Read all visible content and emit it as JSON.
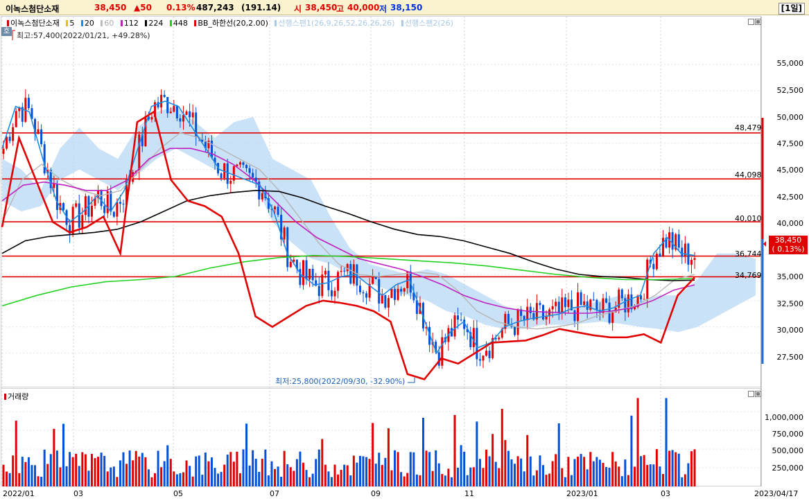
{
  "header": {
    "name": "이녹스첨단소재",
    "price": "38,450",
    "change": "▲50",
    "change_pct": "0.13%",
    "volume": "487,243",
    "volume_change": "(191.14)",
    "open_label": "시",
    "open": "38,450",
    "high_label": "고",
    "high": "40,000",
    "low_label": "저",
    "low": "38,150",
    "period": "[1일]"
  },
  "legend": {
    "title": "이녹스첨단소재",
    "ma5": "5",
    "ma20": "20",
    "ma60": "60",
    "ma112": "112",
    "ma224": "224",
    "ma448": "448",
    "bb": "BB_하한선(20,2.00)",
    "span1": "선행스팬1(26,9,26,52,26,26,26)",
    "span2": "선행스팬2(26)",
    "tag": "호"
  },
  "annotations": {
    "max": "최고:57,400(2022/01/21, +49.28%)",
    "min": "최저:25,800(2022/09/30, -32.90%)"
  },
  "price_axis": [
    "55,000",
    "52,500",
    "50,000",
    "47,500",
    "45,000",
    "42,500",
    "40,000",
    "35,000",
    "32,500",
    "30,000",
    "27,500"
  ],
  "levels": [
    "48,479",
    "44,098",
    "40,010",
    "36,744",
    "34,769"
  ],
  "current_box": {
    "price": "38,450",
    "pct": "( 0.13%)"
  },
  "volume_panel": {
    "label": "거래량",
    "axis": [
      "1,000,000",
      "750,000",
      "500,000",
      "250,000"
    ]
  },
  "x_axis": [
    "2022/01",
    "03",
    "05",
    "07",
    "09",
    "11",
    "2023/01",
    "03",
    "2023/04/17"
  ],
  "colors": {
    "up": "#e00000",
    "down": "#0050d8",
    "ma5": "#e8c000",
    "ma20": "#1e8ae0",
    "ma60": "#b8b8b8",
    "ma112": "#c020c0",
    "ma224": "#000000",
    "ma448": "#22d022",
    "bb": "#e00000",
    "cloud": "#b8d8f4",
    "level": "#e00000"
  },
  "chart_data": {
    "type": "line",
    "title": "",
    "xlabel": "",
    "ylabel": "",
    "ylim": [
      24500,
      58500
    ],
    "y_ticks": [
      27500,
      30000,
      32500,
      35000,
      40000,
      42500,
      45000,
      47500,
      50000,
      52500,
      55000
    ],
    "horizontal_levels": [
      48479,
      44098,
      40010,
      36744,
      34769
    ],
    "last_close": 38450,
    "max_point": {
      "date": "2022/01/21",
      "value": 57400
    },
    "min_point": {
      "date": "2022/09/30",
      "value": 25800
    },
    "series": [
      {
        "name": "20",
        "values": [
          47000,
          51000,
          50500,
          46000,
          42000,
          40000,
          41000,
          42500,
          41000,
          43000,
          47000,
          51000,
          51500,
          51000,
          49000,
          47000,
          45000,
          44500,
          44000,
          43500,
          41000,
          37000,
          35000,
          34000,
          34200,
          34800,
          35000,
          34000,
          33000,
          34000,
          34500,
          31000,
          27500,
          29500,
          30500,
          28000,
          28500,
          30000,
          30500,
          30800,
          31000,
          31200,
          31800,
          32000,
          31500,
          31800,
          32500,
          33000,
          37000,
          38500,
          37000,
          36800
        ]
      },
      {
        "name": "224",
        "values": [
          37000,
          38200,
          38600,
          38800,
          39000,
          39300,
          40000,
          41000,
          42000,
          42500,
          42800,
          43000,
          42900,
          42300,
          41500,
          40800,
          40000,
          39300,
          38800,
          38600,
          38200,
          37600,
          37000,
          36200,
          35500,
          35000,
          34800,
          34700,
          34500,
          34400,
          34450
        ]
      },
      {
        "name": "448",
        "values": [
          32000,
          33000,
          33800,
          34300,
          34500,
          34800,
          35600,
          36200,
          36600,
          36800,
          36700,
          36500,
          36300,
          36100,
          35800,
          35400,
          35000,
          34700,
          34500,
          34500,
          34600
        ]
      },
      {
        "name": "BB_하한선(20,2.00)",
        "values": [
          39500,
          48000,
          44000,
          40000,
          39000,
          39500,
          40500,
          37000,
          49500,
          50500,
          44000,
          42000,
          41500,
          40500,
          37000,
          31000,
          30000,
          31000,
          32000,
          32500,
          32300,
          32000,
          31500,
          30500,
          25500,
          25000,
          27000,
          26500,
          27500,
          28500,
          28600,
          28700,
          29200,
          29800,
          29500,
          29200,
          29000,
          29000,
          29300,
          28500,
          33000,
          34700
        ]
      }
    ],
    "volume": {
      "ylim": [
        0,
        1150000
      ],
      "ticks": [
        250000,
        500000,
        750000,
        1000000
      ]
    }
  }
}
